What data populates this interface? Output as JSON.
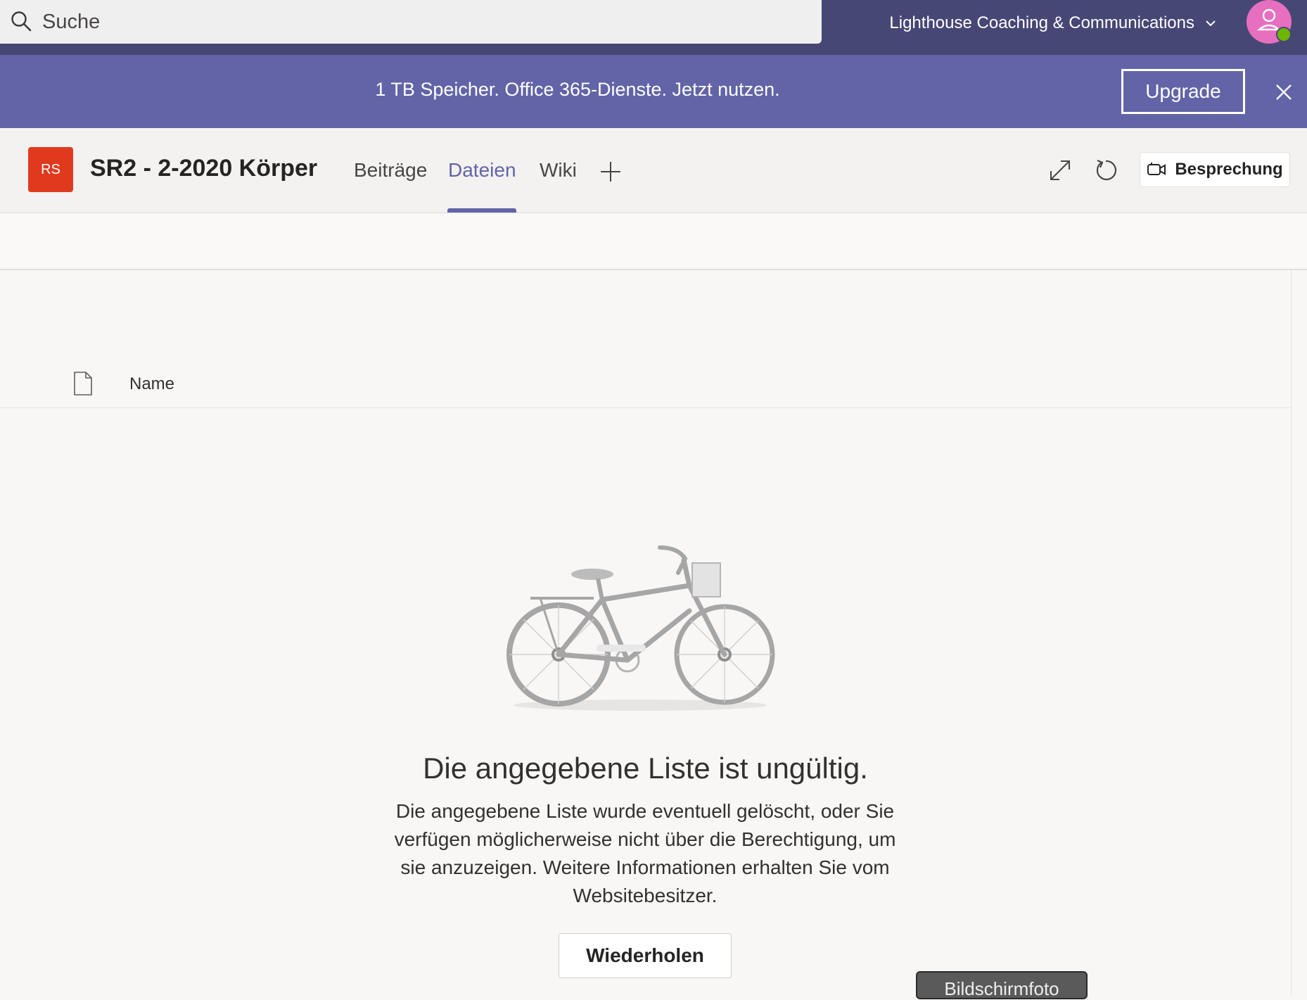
{
  "search": {
    "placeholder": "Suche"
  },
  "org": {
    "name": "Lighthouse Coaching & Communications"
  },
  "banner": {
    "text": "1 TB Speicher. Office 365-Dienste. Jetzt nutzen.",
    "upgrade_label": "Upgrade"
  },
  "team": {
    "avatar_initials": "RS",
    "avatar_color": "#e03a1e",
    "title": "SR2 - 2-2020 Körper"
  },
  "tabs": [
    {
      "label": "Beiträge",
      "active": false
    },
    {
      "label": "Dateien",
      "active": true
    },
    {
      "label": "Wiki",
      "active": false
    }
  ],
  "header_actions": {
    "meeting_label": "Besprechung"
  },
  "files": {
    "column_name": "Name"
  },
  "error": {
    "title": "Die angegebene Liste ist ungültig.",
    "body": "Die angegebene Liste wurde eventuell gelöscht, oder Sie verfügen möglicherweise nicht über die Berechtigung, um sie anzuzeigen. Weitere Informationen erhalten Sie vom Websitebesitzer.",
    "retry_label": "Wiederholen"
  },
  "overlay": {
    "screenshot_label": "Bildschirmfoto"
  },
  "colors": {
    "topbar": "#464775",
    "banner": "#6264a7",
    "accent": "#6264a7",
    "avatar": "#e66fc0",
    "status": "#6bb700"
  },
  "icons": [
    "search-icon",
    "chevron-down-icon",
    "user-icon",
    "close-icon",
    "plus-icon",
    "expand-icon",
    "reload-icon",
    "video-camera-icon",
    "file-icon",
    "bicycle-illustration"
  ]
}
